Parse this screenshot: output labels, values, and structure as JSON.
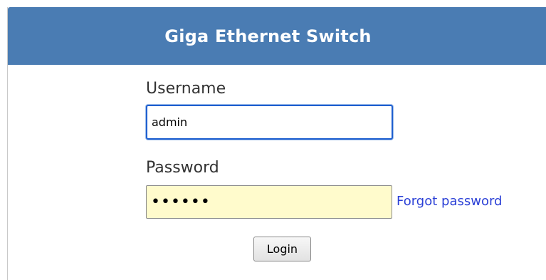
{
  "header": {
    "title": "Giga Ethernet Switch"
  },
  "form": {
    "username_label": "Username",
    "username_value": "admin",
    "password_label": "Password",
    "password_masked": "••••••",
    "forgot_password_label": "Forgot password",
    "login_label": "Login"
  },
  "colors": {
    "header_bg": "#4a7cb3",
    "focus_border": "#1e5fd0",
    "autofill_bg": "#fffbcc",
    "link": "#2a3fd6"
  }
}
